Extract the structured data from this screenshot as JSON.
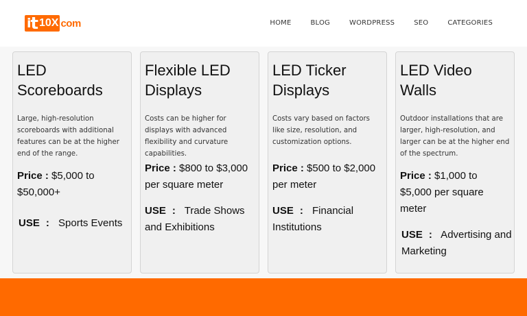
{
  "brand": {
    "logo_text_i": "i",
    "logo_text_t": "t",
    "logo_text_num": "10X",
    "logo_text_com": "com",
    "accent": "#ff6a00"
  },
  "nav": [
    "HOME",
    "BLOG",
    "WORDPRESS",
    "SEO",
    "CATEGORIES"
  ],
  "cards": [
    {
      "title": "LED Scoreboards",
      "desc": "Large, high-resolution scoreboards with additional features can be at the higher end of the range.",
      "price_label": "Price :",
      "price": " $5,000 to $50,000+",
      "use_label": "USE",
      "use_sep": ":",
      "use": " Sports Events"
    },
    {
      "title": "Flexible LED Displays",
      "desc": "Costs can be higher for displays with advanced flexibility and curvature capabilities.",
      "price_label": "Price :",
      "price": " $800 to $3,000 per square meter",
      "use_label": "USE",
      "use_sep": ":",
      "use": " Trade Shows and Exhibitions"
    },
    {
      "title": "LED Ticker Displays",
      "desc": "Costs vary based on factors like size, resolution, and customization options.",
      "price_label": "Price :",
      "price": " $500 to $2,000 per meter",
      "use_label": "USE",
      "use_sep": ":",
      "use": " Financial Institutions"
    },
    {
      "title": "LED Video Walls",
      "desc": "Outdoor installations that are larger, high-resolution, and larger can be at the higher end of the spectrum.",
      "price_label": "Price :",
      "price": " $1,000 to $5,000 per square meter",
      "use_label": "USE",
      "use_sep": ":",
      "use": " Advertising and Marketing"
    }
  ]
}
